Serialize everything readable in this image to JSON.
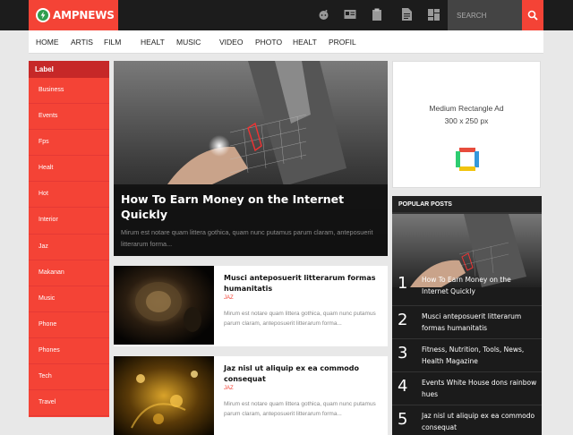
{
  "header": {
    "logo_text": "AMPNEWS",
    "search_placeholder": "SEARCH",
    "icons": [
      "reddit-icon",
      "id-card-icon",
      "clipboard-icon",
      "document-icon",
      "dashboard-icon",
      "search-icon"
    ],
    "colors": {
      "accent": "#f44336",
      "dark": "#1c1c1c"
    }
  },
  "nav": {
    "items": [
      {
        "label": "HOME"
      },
      {
        "label": "ARTIS"
      },
      {
        "label": "FILM"
      },
      {
        "label": "HEALT"
      },
      {
        "label": "MUSIC"
      },
      {
        "label": "VIDEO"
      },
      {
        "label": "PHOTO"
      },
      {
        "label": "HEALT"
      },
      {
        "label": "PROFIL"
      }
    ]
  },
  "labels": {
    "heading": "Label",
    "items": [
      "Business",
      "Events",
      "Fps",
      "Healt",
      "Hot",
      "Interior",
      "Jaz",
      "Makanan",
      "Music",
      "Phone",
      "Phones",
      "Tech",
      "Travel"
    ]
  },
  "featured": {
    "title": "How To Earn Money on the Internet Quickly",
    "excerpt": "Mirum est notare quam littera gothica, quam nunc putamus parum claram, anteposuerit litterarum forma..."
  },
  "articles": [
    {
      "title": "Musci anteposuerit litterarum formas humanitatis",
      "category": "JAZ",
      "excerpt": "Mirum est notare quam littera gothica, quam nunc putamus parum claram, anteposuerit litterarum forma..."
    },
    {
      "title": "Jaz nisl ut aliquip ex ea commodo consequat",
      "category": "JAZ",
      "excerpt": "Mirum est notare quam littera gothica, quam nunc putamus parum claram, anteposuerit litterarum forma..."
    }
  ],
  "ad": {
    "title": "Medium Rectangle Ad",
    "size": "300 x 250 px"
  },
  "popular": {
    "heading": "POPULAR POSTS",
    "items": [
      {
        "num": "1",
        "title": "How To Earn Money on the Internet Quickly"
      },
      {
        "num": "2",
        "title": "Musci anteposuerit litterarum formas humanitatis"
      },
      {
        "num": "3",
        "title": "Fitness, Nutrition, Tools, News, Health Magazine"
      },
      {
        "num": "4",
        "title": "Events White House dons rainbow hues"
      },
      {
        "num": "5",
        "title": "Jaz nisl ut aliquip ex ea commodo consequat"
      }
    ]
  }
}
